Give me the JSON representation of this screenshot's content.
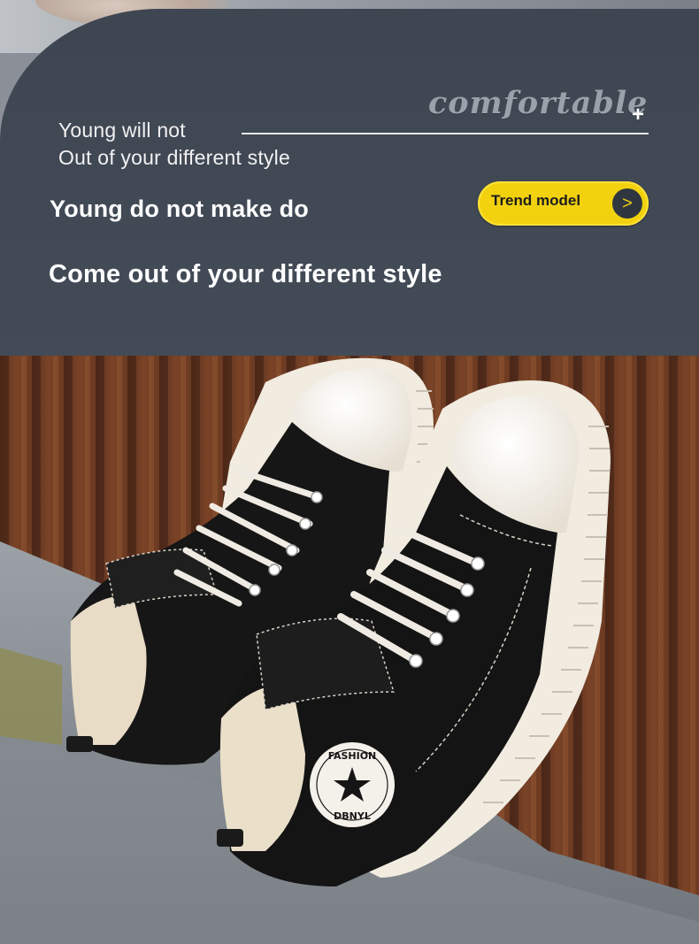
{
  "header": {
    "script_word": "comfortable",
    "plus_symbol": "+",
    "subtitle_line1": "Young will not",
    "subtitle_line2": "Out of your different style",
    "headline1": "Young do not make do",
    "headline2": "Come out of your different style"
  },
  "trend_button": {
    "label": "Trend model",
    "arrow": ">"
  },
  "photo": {
    "description_icon": "canvas-high-top-sneakers",
    "badge_top": "FASHION",
    "badge_bottom": "DBNYL",
    "colors": {
      "panel": "#3e4652",
      "button": "#f2d20f",
      "shoe_black": "#141414",
      "sole": "#efe9de",
      "wood": "#6e3a22"
    }
  }
}
